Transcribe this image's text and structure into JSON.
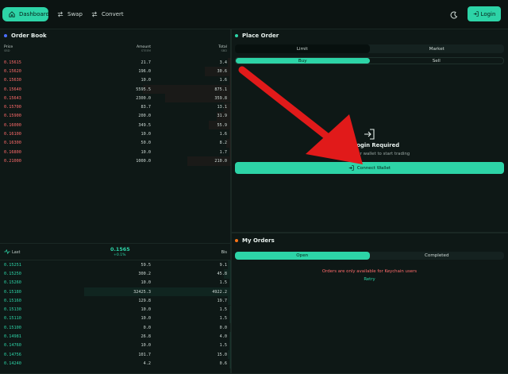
{
  "nav": {
    "items": [
      {
        "label": "Dashboard",
        "icon": "home-icon",
        "active": true
      },
      {
        "label": "Swap",
        "icon": "swap-icon",
        "active": false
      },
      {
        "label": "Convert",
        "icon": "convert-icon",
        "active": false
      }
    ],
    "theme_icon": "moon-icon",
    "login_label": "Login"
  },
  "order_book": {
    "title": "Order Book",
    "headers": {
      "price": "Price",
      "price_sub": "SBD",
      "amount": "Amount",
      "amount_sub": "STEEM",
      "total": "Total",
      "total_sub": "SBD"
    },
    "asks": [
      {
        "price": "0.15615",
        "amount": "21.7",
        "total": "3.4",
        "depth": 0.02
      },
      {
        "price": "0.15620",
        "amount": "196.0",
        "total": "30.6",
        "depth": 0.18
      },
      {
        "price": "0.15630",
        "amount": "10.0",
        "total": "1.6",
        "depth": 0.01
      },
      {
        "price": "0.15640",
        "amount": "5595.5",
        "total": "875.1",
        "depth": 0.6
      },
      {
        "price": "0.15643",
        "amount": "2300.0",
        "total": "359.8",
        "depth": 0.45
      },
      {
        "price": "0.15700",
        "amount": "83.7",
        "total": "13.1",
        "depth": 0.05
      },
      {
        "price": "0.15900",
        "amount": "200.0",
        "total": "31.9",
        "depth": 0.1
      },
      {
        "price": "0.16000",
        "amount": "349.5",
        "total": "55.9",
        "depth": 0.15
      },
      {
        "price": "0.16100",
        "amount": "10.0",
        "total": "1.6",
        "depth": 0.01
      },
      {
        "price": "0.16300",
        "amount": "50.0",
        "total": "8.2",
        "depth": 0.03
      },
      {
        "price": "0.16800",
        "amount": "10.0",
        "total": "1.7",
        "depth": 0.01
      },
      {
        "price": "0.21000",
        "amount": "1000.0",
        "total": "210.0",
        "depth": 0.3
      }
    ],
    "last_label": "Last",
    "last_price": "0.1565",
    "last_change": "+0.1%",
    "bids_header": "Bis",
    "bids": [
      {
        "price": "0.15251",
        "amount": "59.5",
        "total": "9.1",
        "depth": 0.02
      },
      {
        "price": "0.15250",
        "amount": "300.2",
        "total": "45.8",
        "depth": 0.05
      },
      {
        "price": "0.15260",
        "amount": "10.0",
        "total": "1.5",
        "depth": 0.01
      },
      {
        "price": "0.15180",
        "amount": "32425.3",
        "total": "4922.2",
        "depth": 1.0
      },
      {
        "price": "0.15160",
        "amount": "129.8",
        "total": "19.7",
        "depth": 0.02
      },
      {
        "price": "0.15130",
        "amount": "10.0",
        "total": "1.5",
        "depth": 0.01
      },
      {
        "price": "0.15110",
        "amount": "10.0",
        "total": "1.5",
        "depth": 0.01
      },
      {
        "price": "0.15100",
        "amount": "0.0",
        "total": "0.0",
        "depth": 0.0
      },
      {
        "price": "0.14981",
        "amount": "26.8",
        "total": "4.0",
        "depth": 0.01
      },
      {
        "price": "0.14760",
        "amount": "10.0",
        "total": "1.5",
        "depth": 0.01
      },
      {
        "price": "0.14756",
        "amount": "101.7",
        "total": "15.0",
        "depth": 0.02
      },
      {
        "price": "0.14240",
        "amount": "4.2",
        "total": "0.6",
        "depth": 0.01
      }
    ]
  },
  "place_order": {
    "title": "Place Order",
    "order_types": [
      "Limit",
      "Market"
    ],
    "sides": [
      "Buy",
      "Sell"
    ],
    "login_title": "Login Required",
    "login_text": "Connect your wallet to start trading",
    "connect_label": "Connect Wallet"
  },
  "my_orders": {
    "title": "My Orders",
    "tabs": [
      "Open",
      "Completed"
    ],
    "error": "Orders are only available for Keychain users",
    "retry": "Retry"
  },
  "colors": {
    "accent": "#2dd4a7",
    "ask": "#ff6b6b",
    "arrow": "#e11a1a",
    "background": "#0c1412"
  }
}
